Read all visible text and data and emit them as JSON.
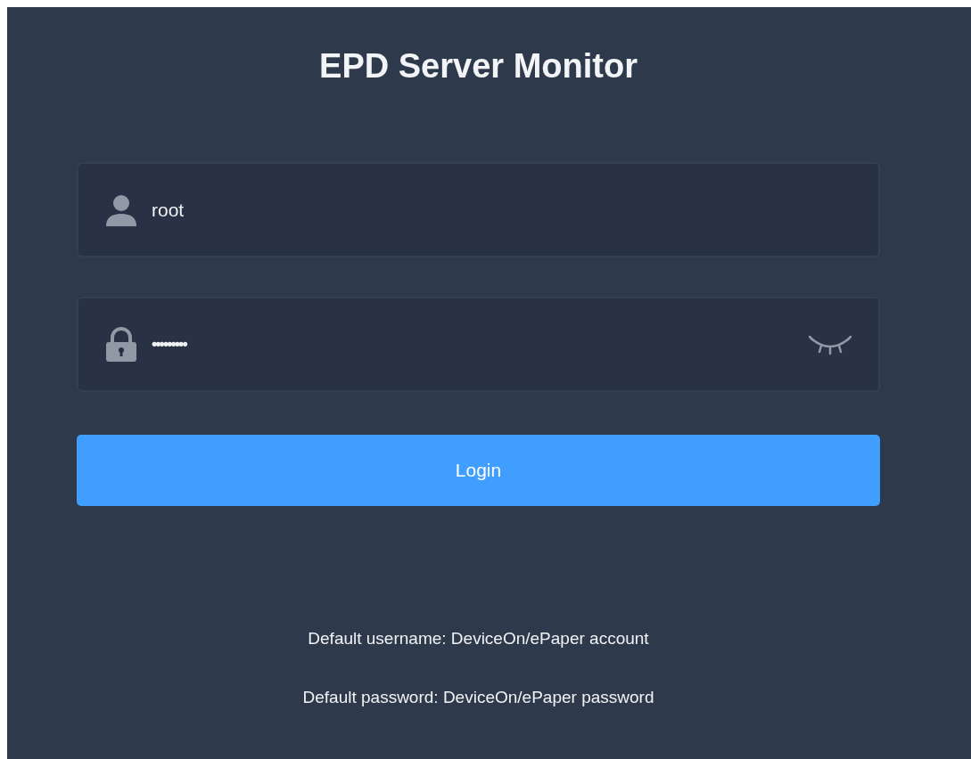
{
  "title": "EPD Server Monitor",
  "fields": [
    {
      "kind": "username",
      "value": "root"
    },
    {
      "kind": "password",
      "value": "•••••••••"
    }
  ],
  "login_button": "Login",
  "notes": [
    "Default username: DeviceOn/ePaper account",
    "Default password: DeviceOn/ePaper password"
  ]
}
